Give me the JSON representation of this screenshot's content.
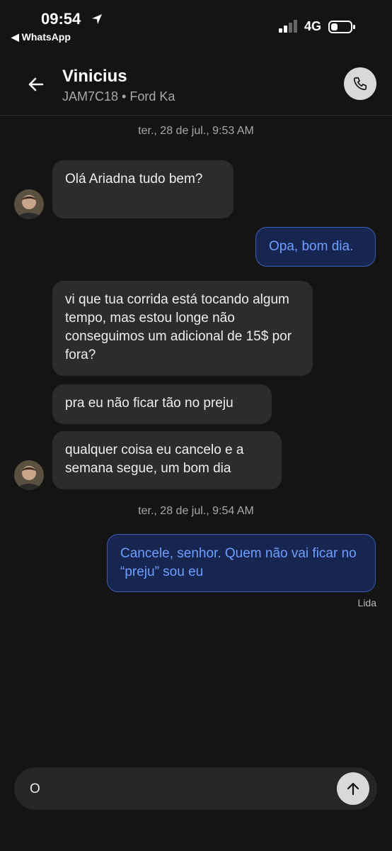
{
  "status_bar": {
    "time": "09:54",
    "back_app": "◀ WhatsApp",
    "network": "4G"
  },
  "header": {
    "name": "Vinicius",
    "subtitle": "JAM7C18 • Ford Ka",
    "icons": [
      "back-arrow-icon",
      "phone-icon"
    ]
  },
  "timestamps": [
    "ter., 28 de jul., 9:53 AM",
    "ter., 28 de jul., 9:54 AM"
  ],
  "messages": [
    {
      "from": "driver",
      "text": "Olá Ariadna tudo bem?"
    },
    {
      "from": "me",
      "text": "Opa, bom dia."
    },
    {
      "from": "driver",
      "text": "vi que tua corrida está tocando algum tempo, mas estou longe não conseguimos um adicional de 15$ por fora?"
    },
    {
      "from": "driver",
      "text": "pra eu não ficar tão no preju"
    },
    {
      "from": "driver",
      "text": "qualquer coisa eu cancelo e a semana segue, um bom dia"
    },
    {
      "from": "me",
      "text": "Cancele, senhor. Quem não vai ficar no “preju” sou eu"
    }
  ],
  "read_receipt": "Lida",
  "composer": {
    "value": "O"
  },
  "colors": {
    "background": "#141414",
    "incoming_bubble": "#2c2c2c",
    "outgoing_bubble": "#172651",
    "outgoing_text": "#6e9eff",
    "outgoing_border": "#3a5cb4"
  }
}
